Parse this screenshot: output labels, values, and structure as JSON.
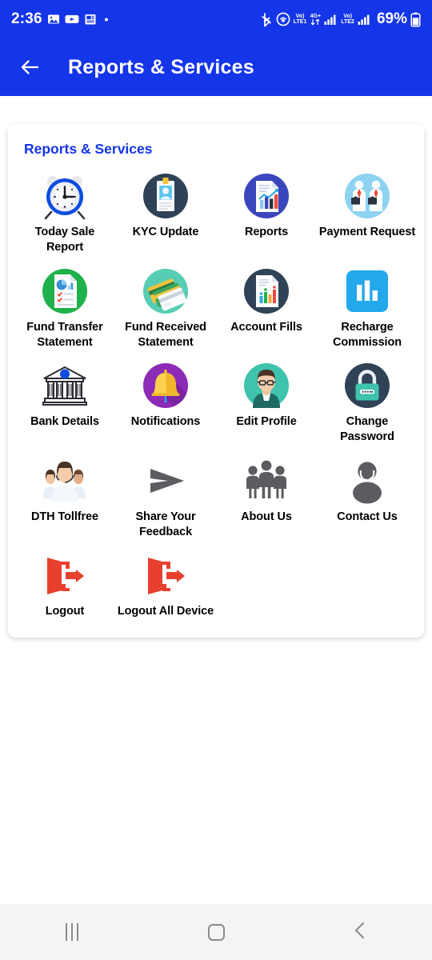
{
  "statusbar": {
    "time": "2:36",
    "battery_percent": "69%",
    "left_icons": [
      "gallery-icon",
      "youtube-icon",
      "news-icon",
      "dot-indicator"
    ],
    "right_icons": [
      "bluetooth-icon",
      "hotspot-icon",
      "volte-lte1-icon",
      "4g-plus-data-icon",
      "signal-bars-1-icon",
      "volte-lte2-icon",
      "signal-bars-2-icon",
      "battery-icon"
    ],
    "volte1_label_top": "Vo)",
    "volte1_label_bottom": "LTE1",
    "volte2_label_top": "Vo)",
    "volte2_label_bottom": "LTE2",
    "data_label": "4G+",
    "accent": "#1535E8"
  },
  "appbar": {
    "back_icon": "back-arrow-icon",
    "title": "Reports & Services",
    "background": "#1535E8"
  },
  "card": {
    "title": "Reports & Services",
    "title_color": "#1535E8"
  },
  "tiles": [
    {
      "label": "Today Sale Report",
      "icon": "alarm-clock-icon"
    },
    {
      "label": "KYC Update",
      "icon": "id-card-icon"
    },
    {
      "label": "Reports",
      "icon": "report-chart-icon"
    },
    {
      "label": "Payment Request",
      "icon": "businessmen-icon"
    },
    {
      "label": "Fund Transfer Statement",
      "icon": "statement-pie-icon"
    },
    {
      "label": "Fund Received Statement",
      "icon": "credit-cards-icon"
    },
    {
      "label": "Account Fills",
      "icon": "account-bars-icon"
    },
    {
      "label": "Recharge Commission",
      "icon": "bar-chart-square-icon"
    },
    {
      "label": "Bank Details",
      "icon": "bank-building-icon"
    },
    {
      "label": "Notifications",
      "icon": "bell-icon"
    },
    {
      "label": "Edit Profile",
      "icon": "avatar-glasses-icon"
    },
    {
      "label": "Change Password",
      "icon": "padlock-icon"
    },
    {
      "label": "DTH Tollfree",
      "icon": "support-team-icon"
    },
    {
      "label": "Share Your Feedback",
      "icon": "send-arrow-icon"
    },
    {
      "label": "About Us",
      "icon": "people-group-icon"
    },
    {
      "label": "Contact Us",
      "icon": "headset-agent-icon"
    },
    {
      "label": "Logout",
      "icon": "logout-door-icon"
    },
    {
      "label": "Logout All Device",
      "icon": "logout-door-icon"
    }
  ],
  "navbar": {
    "recents_icon": "recents-icon",
    "home_icon": "home-icon",
    "back_icon": "back-chevron-icon",
    "background": "#f4f4f4"
  }
}
